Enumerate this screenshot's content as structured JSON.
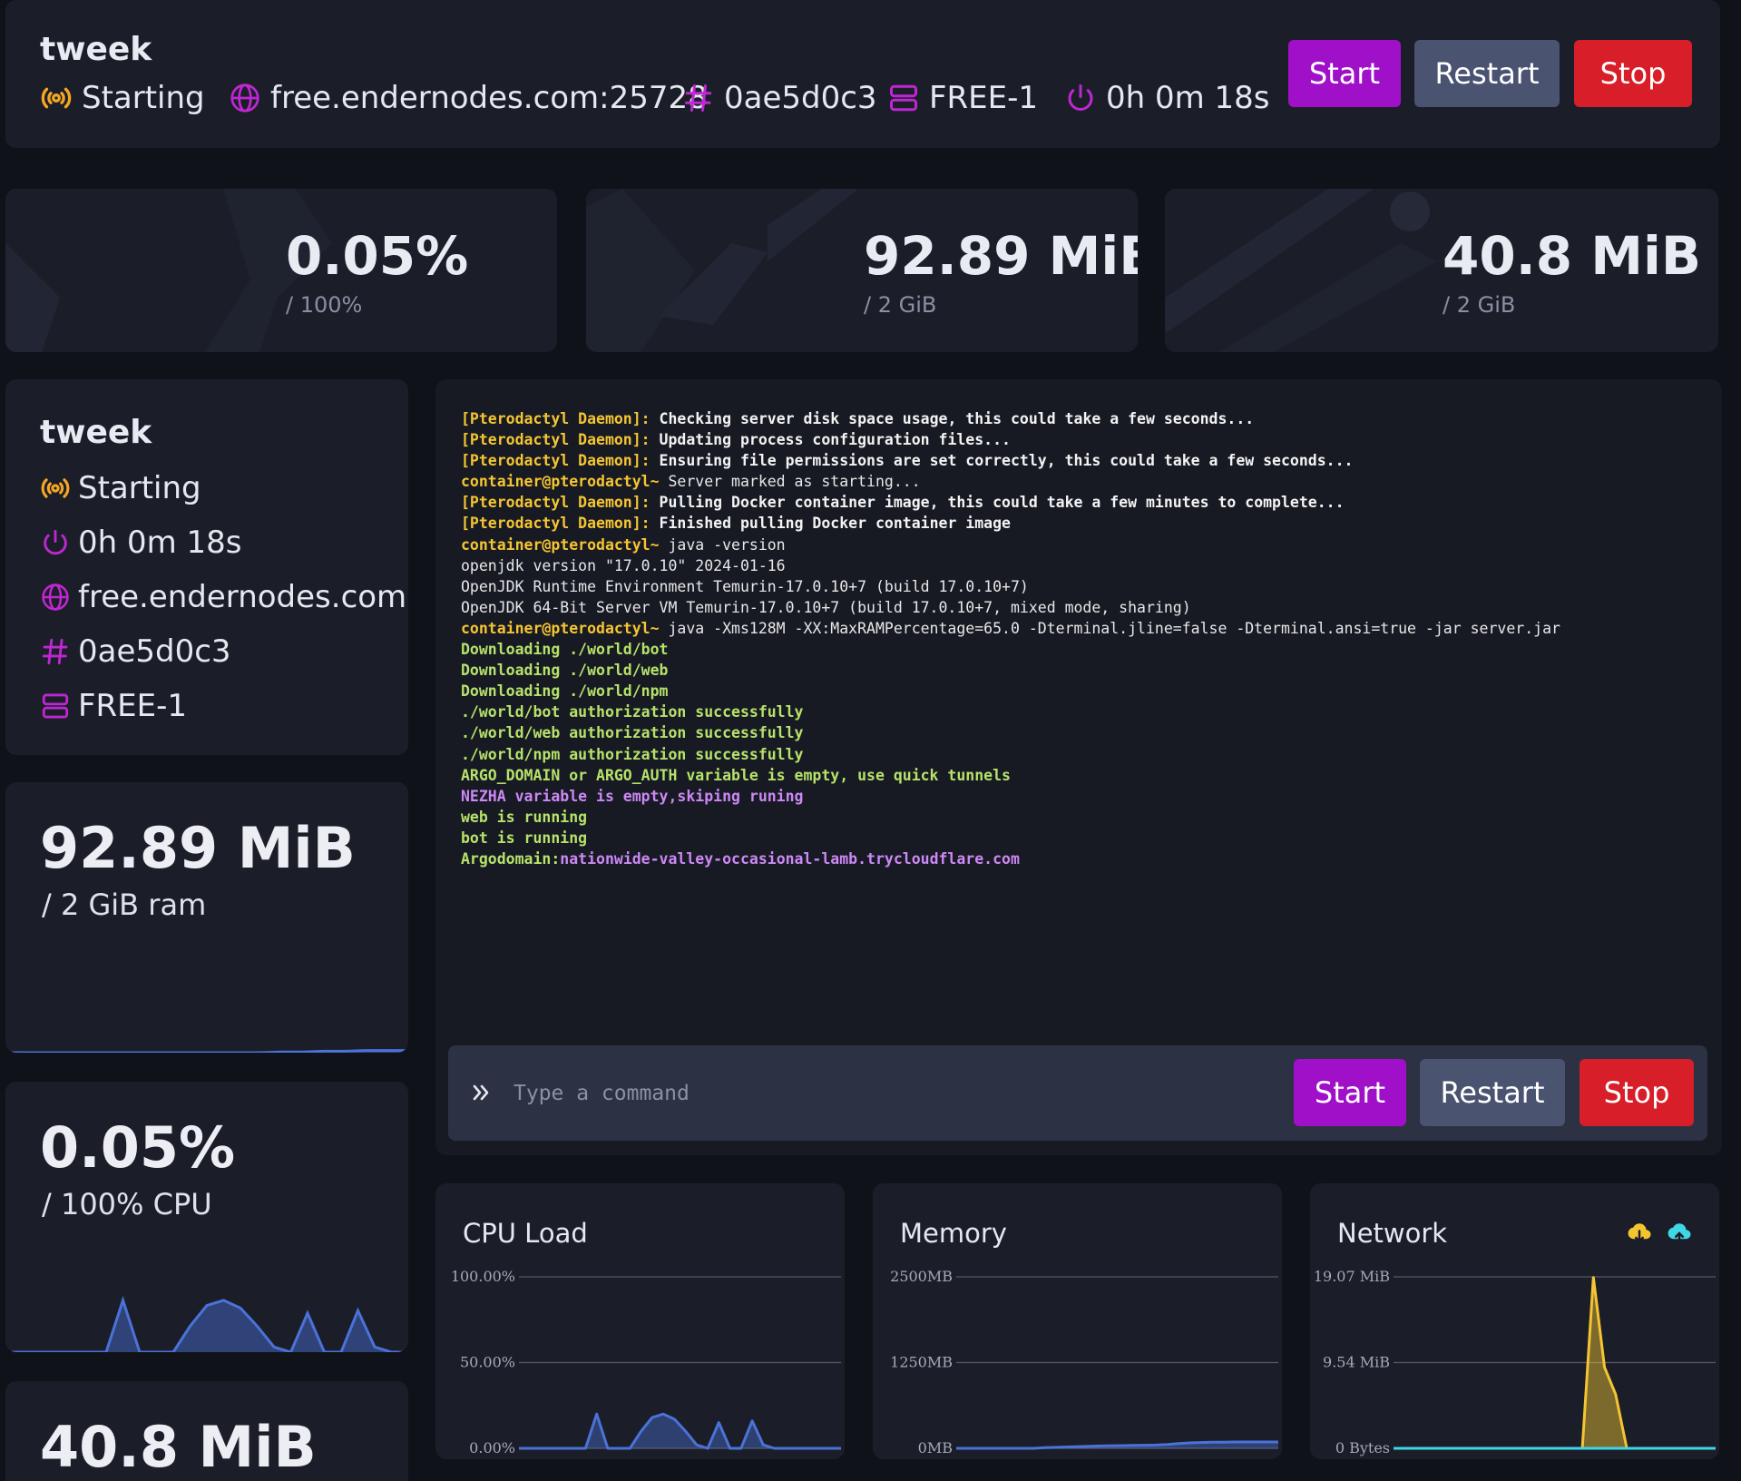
{
  "server": {
    "name": "tweek",
    "status": "Starting",
    "address": "free.endernodes.com:25728",
    "address_truncated": "free.endernodes.com:257",
    "id": "0ae5d0c3",
    "node": "FREE-1",
    "uptime": "0h 0m 18s"
  },
  "buttons": {
    "start": "Start",
    "restart": "Restart",
    "stop": "Stop"
  },
  "stats": {
    "cpu": {
      "value": "0.05%",
      "limit": "/ 100%",
      "sidebar_limit": "/ 100% CPU"
    },
    "memory": {
      "value": "92.89 MiB",
      "limit": "/ 2 GiB",
      "sidebar_limit": "/ 2 GiB ram"
    },
    "disk": {
      "value": "40.8 MiB",
      "limit": "/ 2 GiB"
    }
  },
  "console": {
    "placeholder": "Type a command",
    "lines": [
      [
        {
          "t": "[Pterodactyl Daemon]:",
          "c": "c-yel"
        },
        {
          "t": " Checking server disk space usage, this could take a few seconds...",
          "c": "c-wht"
        }
      ],
      [
        {
          "t": "[Pterodactyl Daemon]:",
          "c": "c-yel"
        },
        {
          "t": " Updating process configuration files...",
          "c": "c-wht"
        }
      ],
      [
        {
          "t": "[Pterodactyl Daemon]:",
          "c": "c-yel"
        },
        {
          "t": " Ensuring file permissions are set correctly, this could take a few seconds...",
          "c": "c-wht"
        }
      ],
      [
        {
          "t": "container@pterodactyl~",
          "c": "c-prm"
        },
        {
          "t": " Server marked as starting...",
          "c": "c-def"
        }
      ],
      [
        {
          "t": "[Pterodactyl Daemon]:",
          "c": "c-yel"
        },
        {
          "t": " Pulling Docker container image, this could take a few minutes to complete...",
          "c": "c-wht"
        }
      ],
      [
        {
          "t": "[Pterodactyl Daemon]:",
          "c": "c-yel"
        },
        {
          "t": " Finished pulling Docker container image",
          "c": "c-wht"
        }
      ],
      [
        {
          "t": "container@pterodactyl~",
          "c": "c-prm"
        },
        {
          "t": " java -version",
          "c": "c-def"
        }
      ],
      [
        {
          "t": "openjdk version \"17.0.10\" 2024-01-16",
          "c": "c-def"
        }
      ],
      [
        {
          "t": "OpenJDK Runtime Environment Temurin-17.0.10+7 (build 17.0.10+7)",
          "c": "c-def"
        }
      ],
      [
        {
          "t": "OpenJDK 64-Bit Server VM Temurin-17.0.10+7 (build 17.0.10+7, mixed mode, sharing)",
          "c": "c-def"
        }
      ],
      [
        {
          "t": "container@pterodactyl~",
          "c": "c-prm"
        },
        {
          "t": " java -Xms128M -XX:MaxRAMPercentage=65.0 -Dterminal.jline=false -Dterminal.ansi=true -jar server.jar",
          "c": "c-def"
        }
      ],
      [
        {
          "t": "Downloading ./world/bot",
          "c": "c-grn"
        }
      ],
      [
        {
          "t": "Downloading ./world/web",
          "c": "c-grn"
        }
      ],
      [
        {
          "t": "Downloading ./world/npm",
          "c": "c-grn"
        }
      ],
      [
        {
          "t": "./world/bot authorization successfully",
          "c": "c-grn"
        }
      ],
      [
        {
          "t": "./world/web authorization successfully",
          "c": "c-grn"
        }
      ],
      [
        {
          "t": "./world/npm authorization successfully",
          "c": "c-grn"
        }
      ],
      [
        {
          "t": "ARGO_DOMAIN or ARGO_AUTH variable is empty, use quick tunnels",
          "c": "c-grn"
        }
      ],
      [
        {
          "t": "NEZHA variable is empty,skiping runing",
          "c": "c-pur"
        }
      ],
      [
        {
          "t": "web is running",
          "c": "c-grn"
        }
      ],
      [
        {
          "t": "bot is running",
          "c": "c-grn"
        }
      ],
      [
        {
          "t": "Argodomain:",
          "c": "c-grn"
        },
        {
          "t": "nationwide-valley-occasional-lamb.trycloudflare.com",
          "c": "c-pur"
        }
      ]
    ]
  },
  "graphs": {
    "cpu": {
      "title": "CPU Load",
      "y_ticks": [
        "100.00%",
        "50.00%",
        "0.00%"
      ],
      "ylim": [
        0,
        100
      ],
      "color": "#4b72d9",
      "values": [
        0,
        0,
        0,
        0,
        0,
        0,
        0,
        20,
        0,
        0,
        0,
        10,
        18,
        20,
        17,
        10,
        2,
        0,
        15,
        0,
        0,
        16,
        2,
        0,
        0,
        0,
        0,
        0,
        0,
        0
      ]
    },
    "memory": {
      "title": "Memory",
      "y_ticks": [
        "2500MB",
        "1250MB",
        "0MB"
      ],
      "ylim": [
        0,
        2500
      ],
      "color": "#4b72d9",
      "values": [
        0,
        0,
        0,
        0,
        0,
        0,
        0,
        0,
        10,
        15,
        20,
        25,
        30,
        35,
        38,
        40,
        42,
        45,
        48,
        55,
        70,
        80,
        85,
        88,
        90,
        92,
        92,
        93,
        93,
        93
      ]
    },
    "network": {
      "title": "Network",
      "y_ticks": [
        "19.07 MiB",
        "9.54 MiB",
        "0 Bytes"
      ],
      "ylim": [
        0,
        19.07
      ],
      "series": [
        {
          "name": "download",
          "color": "#f5c531",
          "values": [
            0,
            0,
            0,
            0,
            0,
            0,
            0,
            0,
            0,
            0,
            0,
            0,
            0,
            0,
            0,
            0,
            0,
            0,
            19.0,
            9.0,
            6.0,
            0,
            0,
            0,
            0,
            0,
            0,
            0,
            0,
            0
          ]
        },
        {
          "name": "upload",
          "color": "#3fd6e6",
          "values": [
            0,
            0,
            0,
            0,
            0,
            0,
            0,
            0,
            0,
            0,
            0,
            0,
            0,
            0,
            0,
            0,
            0,
            0,
            0,
            0,
            0,
            0,
            0,
            0,
            0,
            0,
            0,
            0,
            0,
            0
          ]
        }
      ]
    },
    "sidebar_memory": {
      "color": "#4b72d9",
      "values": [
        0,
        0,
        0,
        0,
        0,
        0,
        0,
        0,
        0,
        0,
        0,
        0,
        0,
        1,
        1,
        2,
        2,
        3,
        3,
        3
      ]
    },
    "sidebar_cpu": {
      "color": "#4b72d9",
      "values": [
        0,
        0,
        0,
        0,
        0,
        0,
        0,
        20,
        0,
        0,
        0,
        10,
        18,
        20,
        17,
        10,
        2,
        0,
        15,
        0,
        0,
        16,
        2,
        0,
        0
      ]
    }
  },
  "colors": {
    "accent": "#a010c8",
    "status_starting": "#f5a623",
    "icon": "#c026d3"
  }
}
